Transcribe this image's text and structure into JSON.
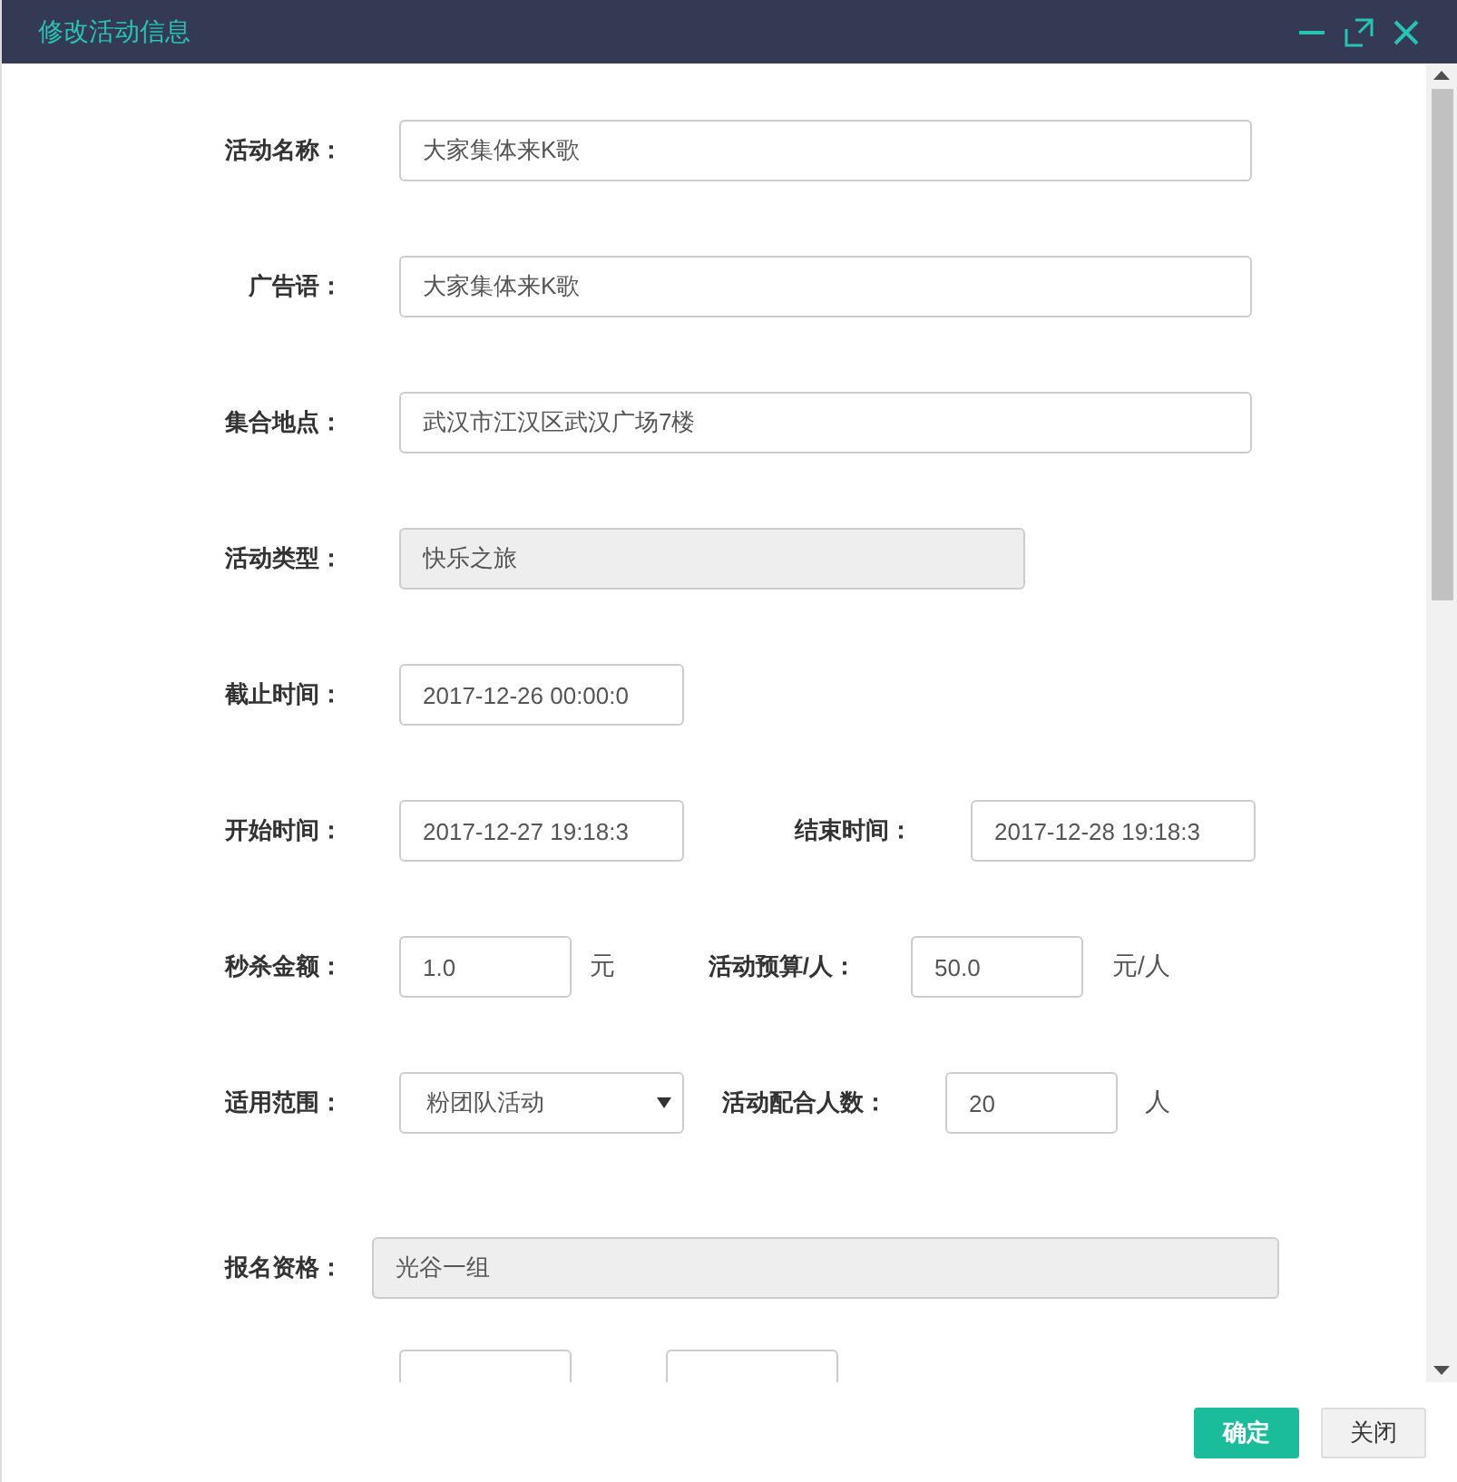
{
  "window": {
    "title": "修改活动信息"
  },
  "form": {
    "activity_name": {
      "label": "活动名称：",
      "value": "大家集体来K歌"
    },
    "slogan": {
      "label": "广告语：",
      "value": "大家集体来K歌"
    },
    "meeting_place": {
      "label": "集合地点：",
      "value": "武汉市江汉区武汉广场7楼"
    },
    "activity_type": {
      "label": "活动类型：",
      "value": "快乐之旅",
      "disabled": true
    },
    "deadline": {
      "label": "截止时间：",
      "value": "2017-12-26 00:00:0"
    },
    "start_time": {
      "label": "开始时间：",
      "value": "2017-12-27 19:18:3"
    },
    "end_time": {
      "label": "结束时间：",
      "value": "2017-12-28 19:18:3"
    },
    "flash_price": {
      "label": "秒杀金额：",
      "value": "1.0",
      "unit": "元"
    },
    "budget": {
      "label": "活动预算/人：",
      "value": "50.0",
      "unit": "元/人"
    },
    "scope": {
      "label": "适用范围：",
      "value": "粉团队活动"
    },
    "participants": {
      "label": "活动配合人数：",
      "value": "20",
      "unit": "人"
    },
    "eligibility": {
      "label": "报名资格：",
      "value": "光谷一组",
      "disabled": true
    }
  },
  "buttons": [
    {
      "label": "确定",
      "kind": "primary"
    },
    {
      "label": "关闭",
      "kind": "default"
    }
  ]
}
